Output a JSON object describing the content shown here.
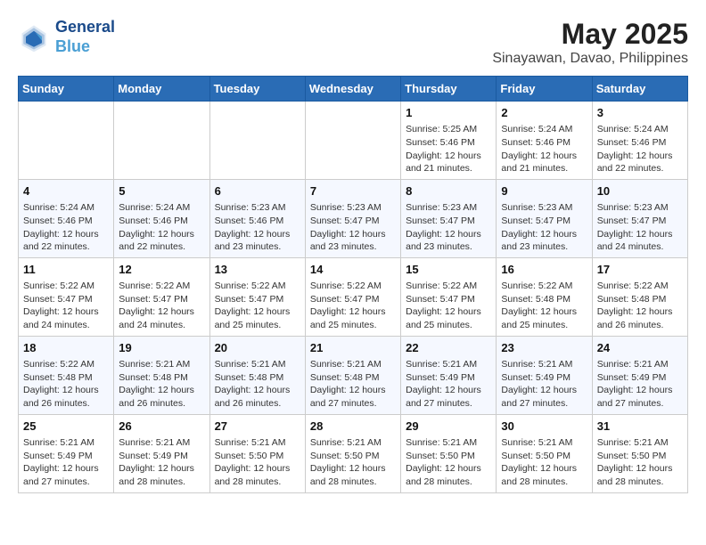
{
  "header": {
    "logo_line1": "General",
    "logo_line2": "Blue",
    "title": "May 2025",
    "subtitle": "Sinayawan, Davao, Philippines"
  },
  "days_of_week": [
    "Sunday",
    "Monday",
    "Tuesday",
    "Wednesday",
    "Thursday",
    "Friday",
    "Saturday"
  ],
  "weeks": [
    {
      "days": [
        {
          "number": "",
          "info": ""
        },
        {
          "number": "",
          "info": ""
        },
        {
          "number": "",
          "info": ""
        },
        {
          "number": "",
          "info": ""
        },
        {
          "number": "1",
          "info": "Sunrise: 5:25 AM\nSunset: 5:46 PM\nDaylight: 12 hours\nand 21 minutes."
        },
        {
          "number": "2",
          "info": "Sunrise: 5:24 AM\nSunset: 5:46 PM\nDaylight: 12 hours\nand 21 minutes."
        },
        {
          "number": "3",
          "info": "Sunrise: 5:24 AM\nSunset: 5:46 PM\nDaylight: 12 hours\nand 22 minutes."
        }
      ]
    },
    {
      "days": [
        {
          "number": "4",
          "info": "Sunrise: 5:24 AM\nSunset: 5:46 PM\nDaylight: 12 hours\nand 22 minutes."
        },
        {
          "number": "5",
          "info": "Sunrise: 5:24 AM\nSunset: 5:46 PM\nDaylight: 12 hours\nand 22 minutes."
        },
        {
          "number": "6",
          "info": "Sunrise: 5:23 AM\nSunset: 5:46 PM\nDaylight: 12 hours\nand 23 minutes."
        },
        {
          "number": "7",
          "info": "Sunrise: 5:23 AM\nSunset: 5:47 PM\nDaylight: 12 hours\nand 23 minutes."
        },
        {
          "number": "8",
          "info": "Sunrise: 5:23 AM\nSunset: 5:47 PM\nDaylight: 12 hours\nand 23 minutes."
        },
        {
          "number": "9",
          "info": "Sunrise: 5:23 AM\nSunset: 5:47 PM\nDaylight: 12 hours\nand 23 minutes."
        },
        {
          "number": "10",
          "info": "Sunrise: 5:23 AM\nSunset: 5:47 PM\nDaylight: 12 hours\nand 24 minutes."
        }
      ]
    },
    {
      "days": [
        {
          "number": "11",
          "info": "Sunrise: 5:22 AM\nSunset: 5:47 PM\nDaylight: 12 hours\nand 24 minutes."
        },
        {
          "number": "12",
          "info": "Sunrise: 5:22 AM\nSunset: 5:47 PM\nDaylight: 12 hours\nand 24 minutes."
        },
        {
          "number": "13",
          "info": "Sunrise: 5:22 AM\nSunset: 5:47 PM\nDaylight: 12 hours\nand 25 minutes."
        },
        {
          "number": "14",
          "info": "Sunrise: 5:22 AM\nSunset: 5:47 PM\nDaylight: 12 hours\nand 25 minutes."
        },
        {
          "number": "15",
          "info": "Sunrise: 5:22 AM\nSunset: 5:47 PM\nDaylight: 12 hours\nand 25 minutes."
        },
        {
          "number": "16",
          "info": "Sunrise: 5:22 AM\nSunset: 5:48 PM\nDaylight: 12 hours\nand 25 minutes."
        },
        {
          "number": "17",
          "info": "Sunrise: 5:22 AM\nSunset: 5:48 PM\nDaylight: 12 hours\nand 26 minutes."
        }
      ]
    },
    {
      "days": [
        {
          "number": "18",
          "info": "Sunrise: 5:22 AM\nSunset: 5:48 PM\nDaylight: 12 hours\nand 26 minutes."
        },
        {
          "number": "19",
          "info": "Sunrise: 5:21 AM\nSunset: 5:48 PM\nDaylight: 12 hours\nand 26 minutes."
        },
        {
          "number": "20",
          "info": "Sunrise: 5:21 AM\nSunset: 5:48 PM\nDaylight: 12 hours\nand 26 minutes."
        },
        {
          "number": "21",
          "info": "Sunrise: 5:21 AM\nSunset: 5:48 PM\nDaylight: 12 hours\nand 27 minutes."
        },
        {
          "number": "22",
          "info": "Sunrise: 5:21 AM\nSunset: 5:49 PM\nDaylight: 12 hours\nand 27 minutes."
        },
        {
          "number": "23",
          "info": "Sunrise: 5:21 AM\nSunset: 5:49 PM\nDaylight: 12 hours\nand 27 minutes."
        },
        {
          "number": "24",
          "info": "Sunrise: 5:21 AM\nSunset: 5:49 PM\nDaylight: 12 hours\nand 27 minutes."
        }
      ]
    },
    {
      "days": [
        {
          "number": "25",
          "info": "Sunrise: 5:21 AM\nSunset: 5:49 PM\nDaylight: 12 hours\nand 27 minutes."
        },
        {
          "number": "26",
          "info": "Sunrise: 5:21 AM\nSunset: 5:49 PM\nDaylight: 12 hours\nand 28 minutes."
        },
        {
          "number": "27",
          "info": "Sunrise: 5:21 AM\nSunset: 5:50 PM\nDaylight: 12 hours\nand 28 minutes."
        },
        {
          "number": "28",
          "info": "Sunrise: 5:21 AM\nSunset: 5:50 PM\nDaylight: 12 hours\nand 28 minutes."
        },
        {
          "number": "29",
          "info": "Sunrise: 5:21 AM\nSunset: 5:50 PM\nDaylight: 12 hours\nand 28 minutes."
        },
        {
          "number": "30",
          "info": "Sunrise: 5:21 AM\nSunset: 5:50 PM\nDaylight: 12 hours\nand 28 minutes."
        },
        {
          "number": "31",
          "info": "Sunrise: 5:21 AM\nSunset: 5:50 PM\nDaylight: 12 hours\nand 28 minutes."
        }
      ]
    }
  ]
}
